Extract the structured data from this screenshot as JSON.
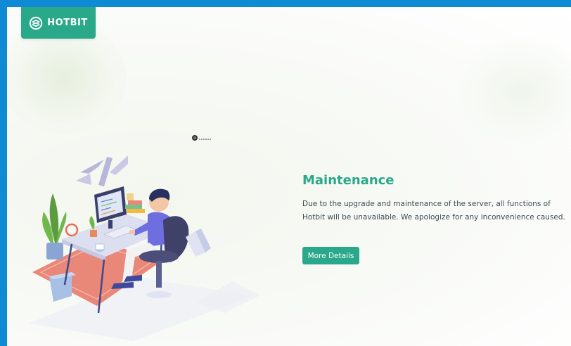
{
  "brand": {
    "name": "HOTBIT"
  },
  "main": {
    "title": "Maintenance",
    "description": "Due to the upgrade and maintenance of the server, all functions of Hotbit will be unavailable. We apologize for any inconvenience caused.",
    "button_label": "More Details"
  },
  "colors": {
    "accent": "#2aa88a",
    "border": "#0f8bd6",
    "text": "#3e4a56"
  },
  "icons": {
    "logo": "hotbit-logo-icon",
    "cursor": "loading-cursor-icon"
  }
}
